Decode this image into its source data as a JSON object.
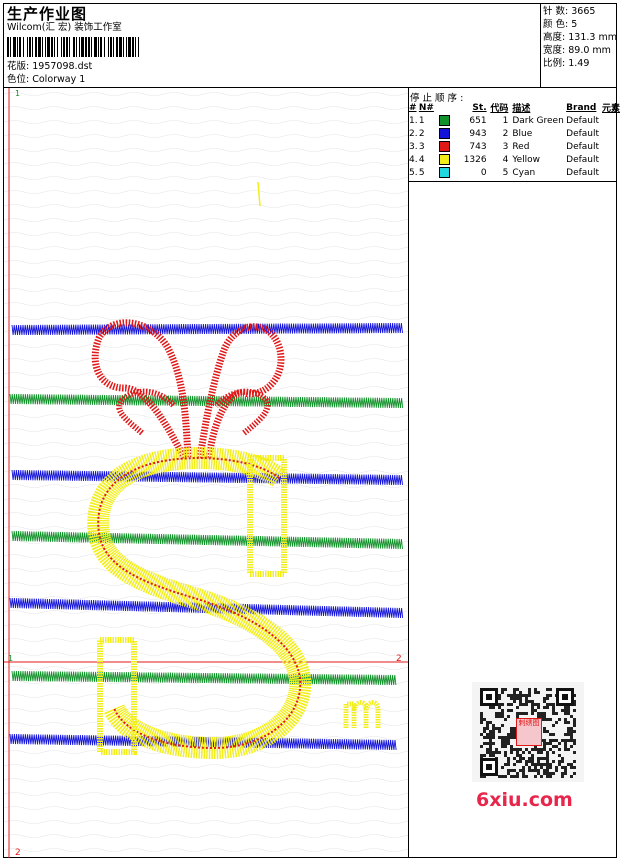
{
  "header": {
    "title": "生产作业图",
    "company": "Wilcom(汇 宏) 装饰工作室",
    "design_label": "花版:",
    "design_value": "1957098.dst",
    "colorway_label": "色位:",
    "colorway_value": "Colorway 1"
  },
  "specs": {
    "stitches_label": "针 数:",
    "stitches_value": "3665",
    "colors_label": "颜 色:",
    "colors_value": "5",
    "height_label": "高度:",
    "height_value": "131.3 mm",
    "width_label": "宽度:",
    "width_value": "89.0 mm",
    "scale_label": "比例:",
    "scale_value": "1.49"
  },
  "stop_sequence": {
    "title": "停 止 顺 序 :",
    "columns": [
      "#",
      "N#",
      "St.",
      "代码",
      "描述",
      "Brand",
      "元素"
    ],
    "rows": [
      {
        "num": "1.",
        "n": "1",
        "color": "#12922a",
        "st": "651",
        "code": "1",
        "desc": "Dark Green",
        "brand": "Default"
      },
      {
        "num": "2.",
        "n": "2",
        "color": "#1414d8",
        "st": "943",
        "code": "2",
        "desc": "Blue",
        "brand": "Default"
      },
      {
        "num": "3.",
        "n": "3",
        "color": "#e01818",
        "st": "743",
        "code": "3",
        "desc": "Red",
        "brand": "Default"
      },
      {
        "num": "4.",
        "n": "4",
        "color": "#f2ee1a",
        "st": "1326",
        "code": "4",
        "desc": "Yellow",
        "brand": "Default"
      },
      {
        "num": "5.",
        "n": "5",
        "color": "#1fd8e0",
        "st": "0",
        "code": "5",
        "desc": "Cyan",
        "brand": "Default"
      }
    ]
  },
  "canvas": {
    "marker_top_left": "1",
    "marker_mid_left": "1",
    "marker_mid_right": "2",
    "marker_bottom_left": "2",
    "guide_color": "#e01818"
  },
  "watermark": {
    "text": "6xiu.com",
    "qr_label": "刺绣图"
  }
}
